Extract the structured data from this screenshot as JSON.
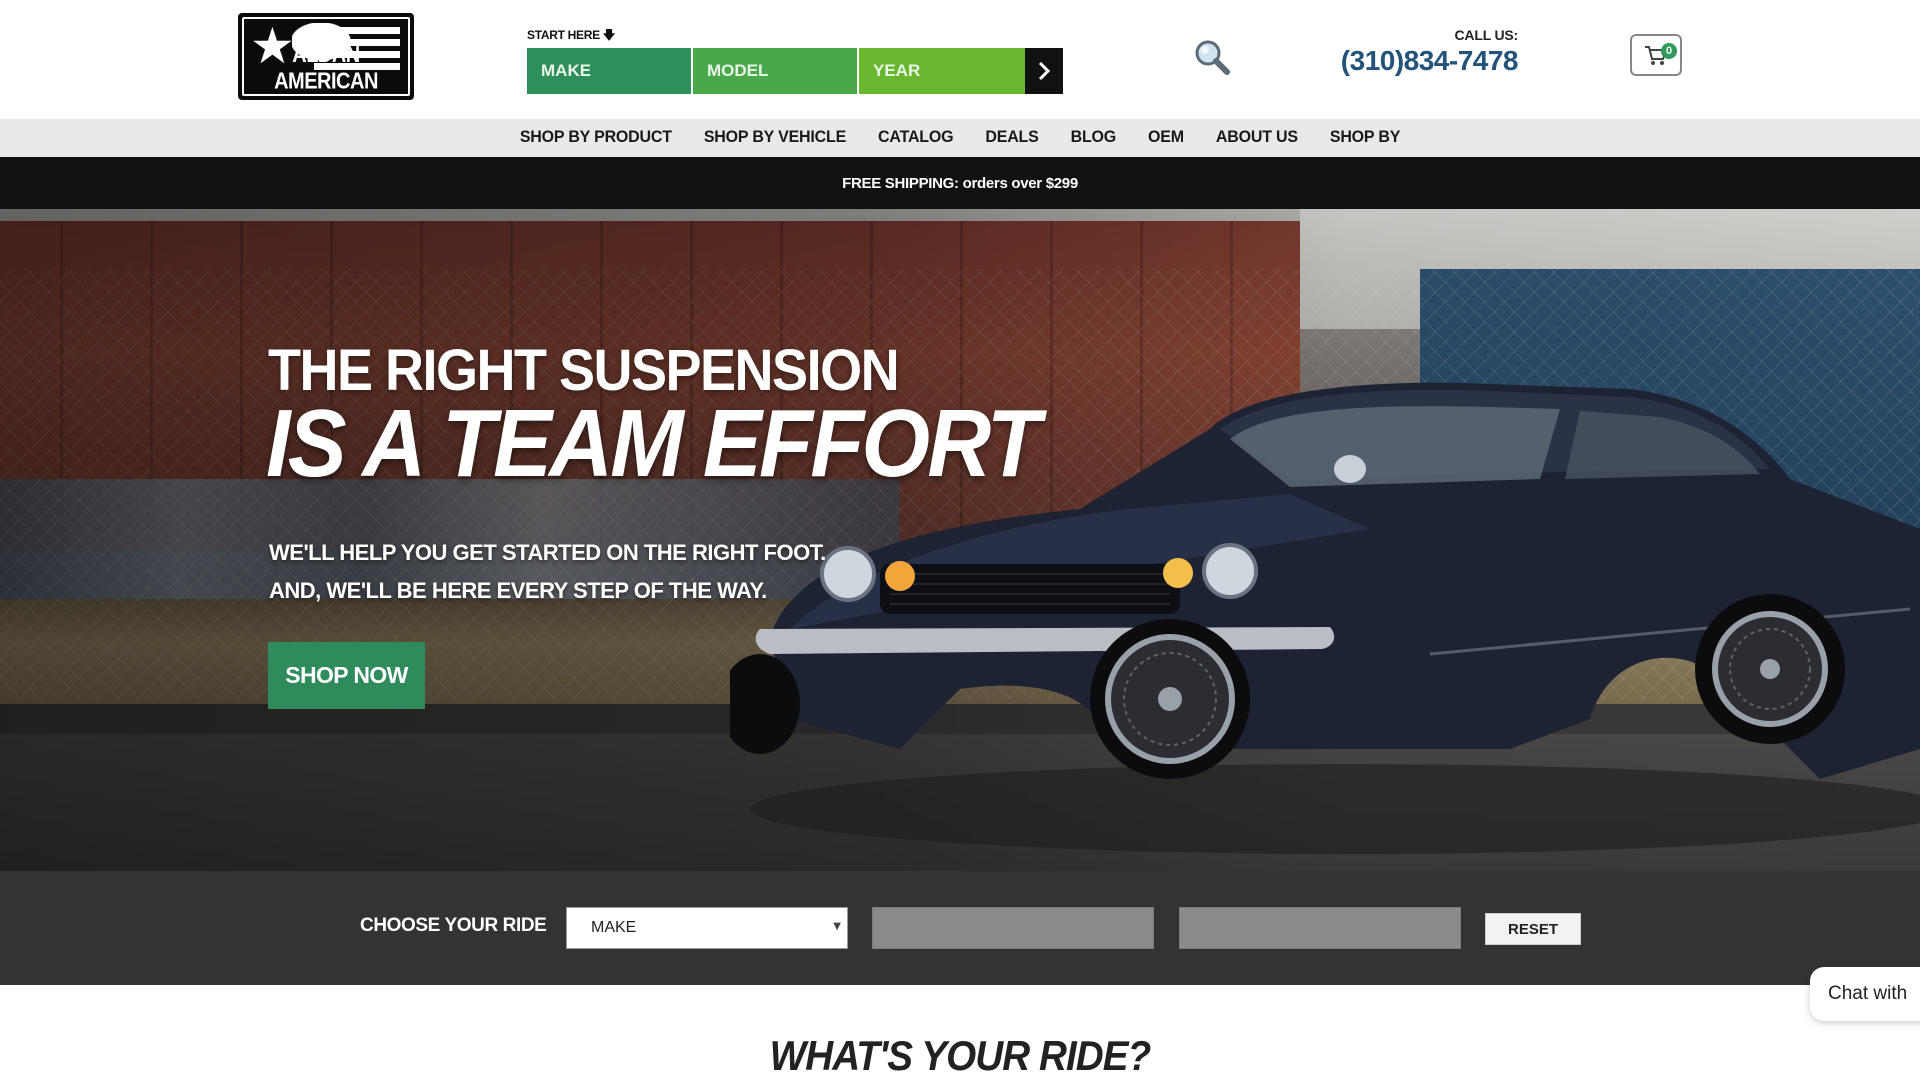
{
  "header": {
    "logo_text": "ALDAN AMERICAN",
    "start_here": "START HERE",
    "ymm": {
      "make": "MAKE",
      "model": "MODEL",
      "year": "YEAR",
      "go_icon": "chevron-right-icon"
    },
    "call_label": "CALL US:",
    "phone": "(310)834-7478",
    "cart_count": "0",
    "colors": {
      "green_dark": "#2f8f5a",
      "green_mid": "#48a84a",
      "green_light": "#69b72e",
      "phone": "#23527a"
    }
  },
  "nav": {
    "items": [
      "SHOP BY PRODUCT",
      "SHOP BY VEHICLE",
      "CATALOG",
      "DEALS",
      "BLOG",
      "OEM",
      "ABOUT US",
      "SHOP BY"
    ]
  },
  "shipping_banner": "FREE SHIPPING: orders over $299",
  "hero": {
    "title_line1": "THE RIGHT SUSPENSION",
    "title_line2": "IS A TEAM EFFORT",
    "subtitle_line1": "WE'LL HELP YOU GET STARTED ON THE RIGHT FOOT.",
    "subtitle_line2": "AND, WE'LL BE HERE EVERY STEP OF THE WAY.",
    "cta": "SHOP NOW"
  },
  "ride": {
    "label": "CHOOSE YOUR RIDE",
    "make_value": "MAKE",
    "reset": "RESET"
  },
  "section_title": "WHAT'S YOUR RIDE?",
  "chat_label": "Chat with"
}
